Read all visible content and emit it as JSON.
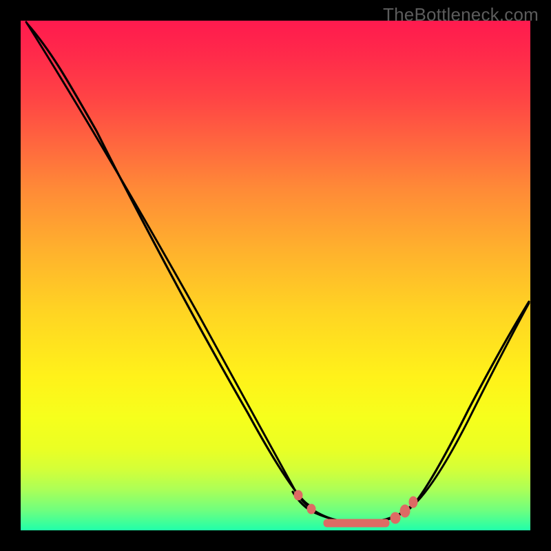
{
  "watermark": "TheBottleneck.com",
  "chart_data": {
    "type": "line",
    "title": "",
    "xlabel": "",
    "ylabel": "",
    "xlim": [
      0,
      100
    ],
    "ylim": [
      0,
      100
    ],
    "x": [
      0,
      5,
      10,
      15,
      20,
      25,
      30,
      35,
      40,
      45,
      50,
      55,
      58,
      60,
      62,
      65,
      70,
      75,
      80,
      85,
      90,
      95,
      100
    ],
    "values": [
      100,
      93,
      85,
      76,
      67,
      58,
      49,
      40,
      31,
      22,
      13,
      6,
      3,
      2,
      1,
      0,
      0,
      1,
      4,
      10,
      18,
      28,
      40
    ],
    "series": [
      {
        "name": "curve",
        "values": [
          100,
          93,
          85,
          76,
          67,
          58,
          49,
          40,
          31,
          22,
          13,
          6,
          3,
          2,
          1,
          0,
          0,
          1,
          4,
          10,
          18,
          28,
          40
        ]
      }
    ],
    "annotations": {
      "optimal_region_x": [
        55,
        75
      ],
      "marker_color": "#e06660"
    }
  },
  "colors": {
    "background": "#000000",
    "gradient_top": "#ff1a4e",
    "gradient_bottom": "#20ffaa",
    "curve": "#000000",
    "marker": "#e06660",
    "watermark": "#5c5c5c"
  }
}
